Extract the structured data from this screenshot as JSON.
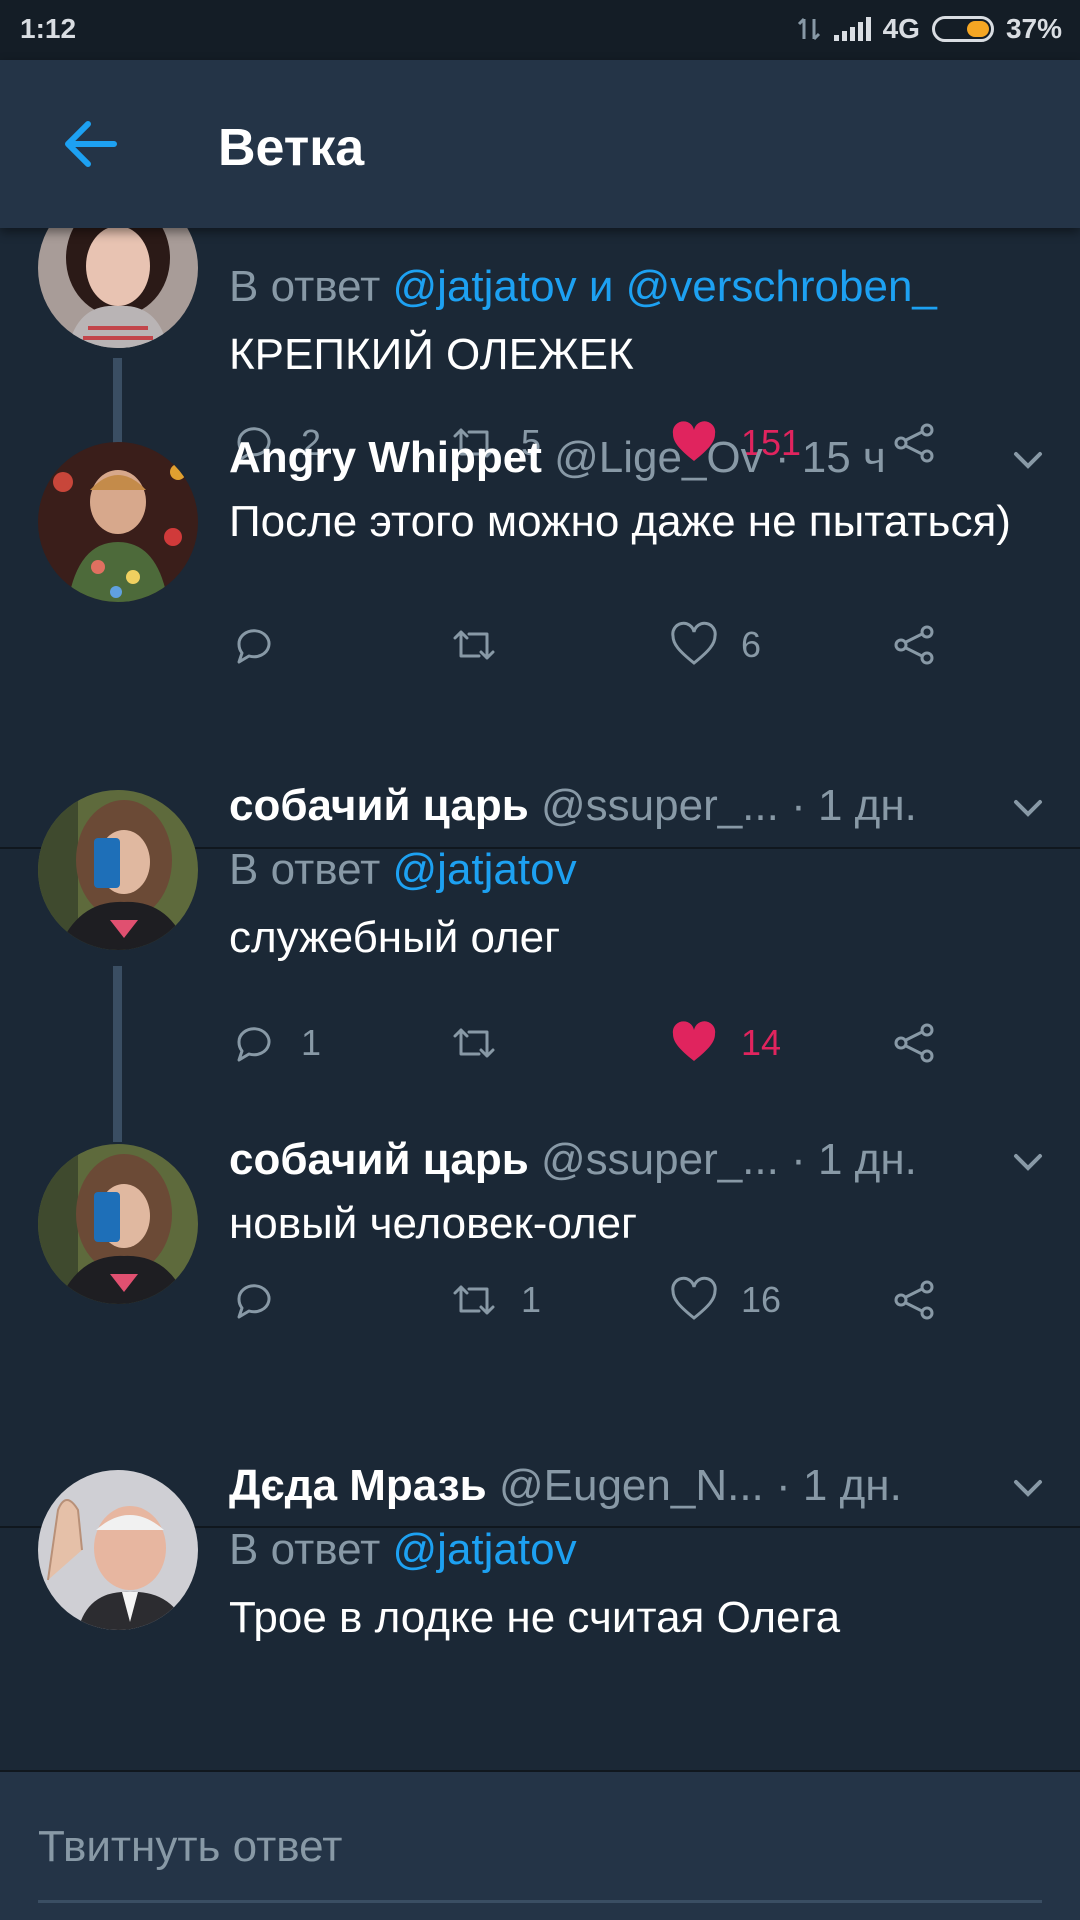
{
  "status_bar": {
    "time": "1:12",
    "network": "4G",
    "battery": "37%",
    "battery_level": 0.37
  },
  "header": {
    "title": "Ветка"
  },
  "tweets": [
    {
      "reply_prefix": "В ответ",
      "reply_to_1": "@jatjatov",
      "reply_and": "и",
      "reply_to_2": "@verschroben_",
      "text": "КРЕПКИЙ ОЛЕЖЕК",
      "reply_count": "2",
      "retweet_count": "5",
      "like_count": "151",
      "liked": true
    },
    {
      "name": "Angry Whippet",
      "handle": "@Lige_Ov",
      "time": "· 15 ч",
      "text": "После этого можно даже не пытаться)",
      "reply_count": "",
      "retweet_count": "",
      "like_count": "6",
      "liked": false
    },
    {
      "name": "собачий царь",
      "handle": "@ssuper_...",
      "time": "· 1 дн.",
      "reply_prefix": "В ответ",
      "reply_to_1": "@jatjatov",
      "text": "служебный олег",
      "reply_count": "1",
      "retweet_count": "",
      "like_count": "14",
      "liked": true
    },
    {
      "name": "собачий царь",
      "handle": "@ssuper_...",
      "time": "· 1 дн.",
      "text": "новый человек-олег",
      "reply_count": "",
      "retweet_count": "1",
      "like_count": "16",
      "liked": false
    },
    {
      "name": "Дєда Мразь",
      "handle": "@Eugen_N...",
      "time": "· 1 дн.",
      "reply_prefix": "В ответ",
      "reply_to_1": "@jatjatov",
      "text": "Трое в лодке не считая Олега"
    }
  ],
  "reply_bar": {
    "placeholder": "Твитнуть ответ"
  },
  "colors": {
    "background": "#1b2836",
    "header": "#243447",
    "accent": "#1da1f2",
    "like": "#e0245e",
    "muted": "#8899a6"
  },
  "icons": [
    "back-arrow-icon",
    "reply-icon",
    "retweet-icon",
    "heart-icon",
    "share-icon",
    "chevron-down-icon",
    "signal-icon",
    "battery-icon"
  ]
}
